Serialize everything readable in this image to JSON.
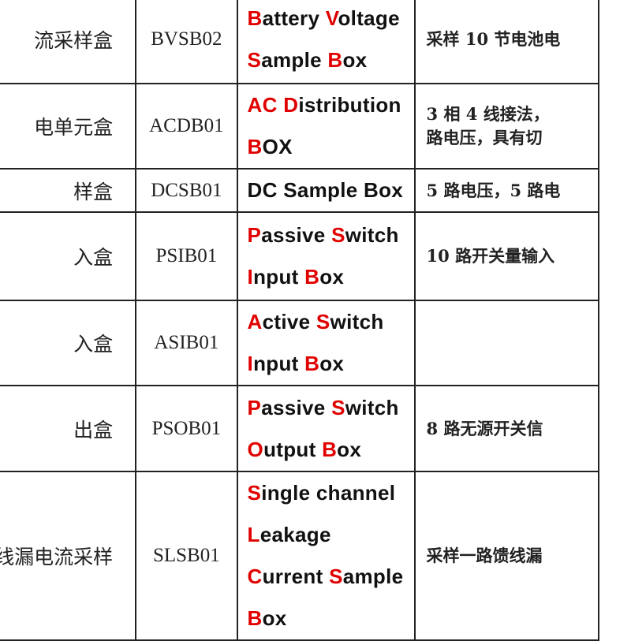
{
  "accent_color": "#e00000",
  "rows": [
    {
      "name_cn": "流采样盒",
      "code": "BVSB02",
      "english": [
        [
          "B",
          "attery "
        ],
        [
          "V",
          "oltage "
        ],
        [
          "S",
          "ample "
        ],
        [
          "B",
          "ox"
        ]
      ],
      "lines": [
        2,
        4
      ],
      "desc": [
        "采样 10 节电池电"
      ]
    },
    {
      "name_cn": "电单元盒",
      "code": "ACDB01",
      "english": [
        [
          "AC ",
          ""
        ],
        [
          "D",
          "istribution "
        ],
        [
          "B",
          "OX"
        ]
      ],
      "lines": [
        2
      ],
      "desc": [
        "3 相 4 线接法，",
        "路电压，具有切"
      ]
    },
    {
      "name_cn": "样盒",
      "code": "DCSB01",
      "english": [
        [
          "",
          "DC Sample Box"
        ]
      ],
      "lines": [],
      "desc": [
        "5 路电压，5 路电"
      ]
    },
    {
      "name_cn": "入盒",
      "code": "PSIB01",
      "english": [
        [
          "P",
          "assive "
        ],
        [
          "S",
          "witch "
        ],
        [
          "I",
          "nput "
        ],
        [
          "B",
          "ox"
        ]
      ],
      "lines": [
        2
      ],
      "desc": [
        "10 路开关量输入"
      ]
    },
    {
      "name_cn": "入盒",
      "code": "ASIB01",
      "english": [
        [
          "A",
          "ctive "
        ],
        [
          "S",
          "witch "
        ],
        [
          "I",
          "nput "
        ],
        [
          "B",
          "ox"
        ]
      ],
      "lines": [
        2
      ],
      "desc": [
        ""
      ]
    },
    {
      "name_cn": "出盒",
      "code": "PSOB01",
      "english": [
        [
          "P",
          "assive "
        ],
        [
          "S",
          "witch "
        ],
        [
          "O",
          "utput "
        ],
        [
          "B",
          "ox"
        ]
      ],
      "lines": [
        2
      ],
      "desc": [
        "8 路无源开关信"
      ]
    },
    {
      "name_cn": "线漏电流采样",
      "code": "SLSB01",
      "english": [
        [
          "S",
          "ingle channel "
        ],
        [
          "L",
          "eakage "
        ],
        [
          "C",
          "urrent "
        ],
        [
          "S",
          "ample "
        ],
        [
          "B",
          "ox"
        ]
      ],
      "lines": [
        1,
        2,
        4
      ],
      "desc": [
        "采样一路馈线漏"
      ]
    }
  ]
}
